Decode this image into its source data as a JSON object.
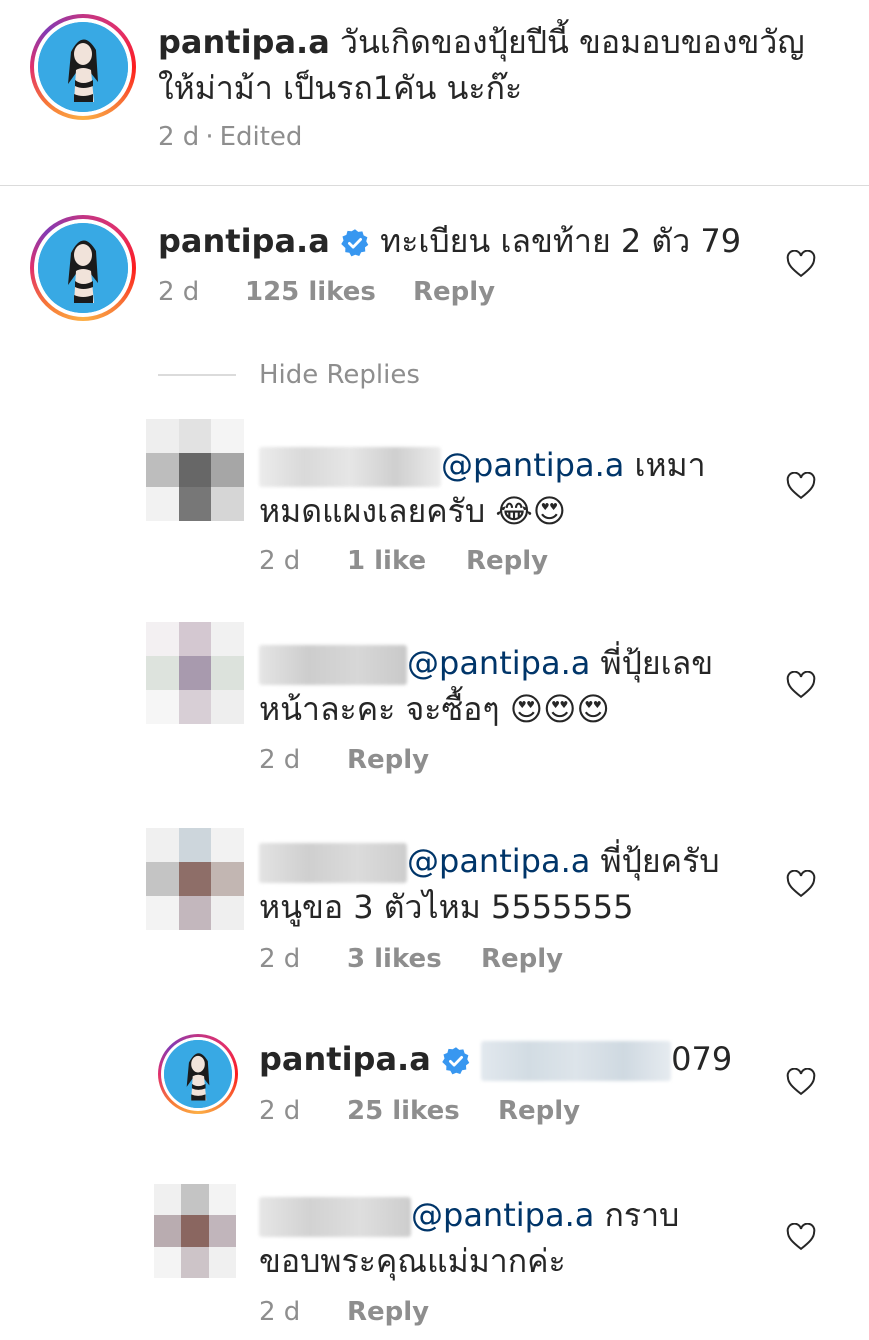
{
  "caption": {
    "username": "pantipa.a",
    "text_line1": "วันเกิดของปุ้ยปีนี้ ขอมอบของขวัญ",
    "text_line2": "ให้ม่าม้า เป็นรถ1คัน นะก๊ะ",
    "time": "2 d",
    "separator": "·",
    "edited": "Edited"
  },
  "comment_main": {
    "username": "pantipa.a",
    "text": "ทะเบียน เลขท้าย 2 ตัว 79",
    "time": "2 d",
    "likes": "125 likes",
    "reply_label": "Reply"
  },
  "hide_replies_label": "Hide Replies",
  "replies": [
    {
      "mention": "@pantipa.a",
      "text_after_mention": " เหมา",
      "text_line2": "หมดแผงเลยครับ 😂😍",
      "time": "2 d",
      "likes": "1 like",
      "reply_label": "Reply"
    },
    {
      "mention": "@pantipa.a",
      "text_after_mention": " พี่ปุ้ยเลข",
      "text_line2": "หน้าละคะ จะซื้อๆ 😍😍😍",
      "time": "2 d",
      "reply_label": "Reply"
    },
    {
      "mention": "@pantipa.a",
      "text_after_mention": " พี่ปุ้ยครับ",
      "text_line2": "หนูขอ 3 ตัวไหม  5555555",
      "time": "2 d",
      "likes": "3 likes",
      "reply_label": "Reply"
    },
    {
      "username": "pantipa.a",
      "text_after_blur": "079",
      "time": "2 d",
      "likes": "25 likes",
      "reply_label": "Reply"
    },
    {
      "mention": "@pantipa.a",
      "text_after_mention": " กราบ",
      "text_line2": "ขอบพระคุณแม่มากค่ะ",
      "time": "2 d",
      "reply_label": "Reply"
    }
  ],
  "icons": {
    "heart": "heart-outline-icon",
    "verified": "verified-badge-icon"
  },
  "colors": {
    "verified_blue": "#3897f0",
    "mention_blue": "#003569",
    "meta_gray": "#8e8e8e"
  }
}
